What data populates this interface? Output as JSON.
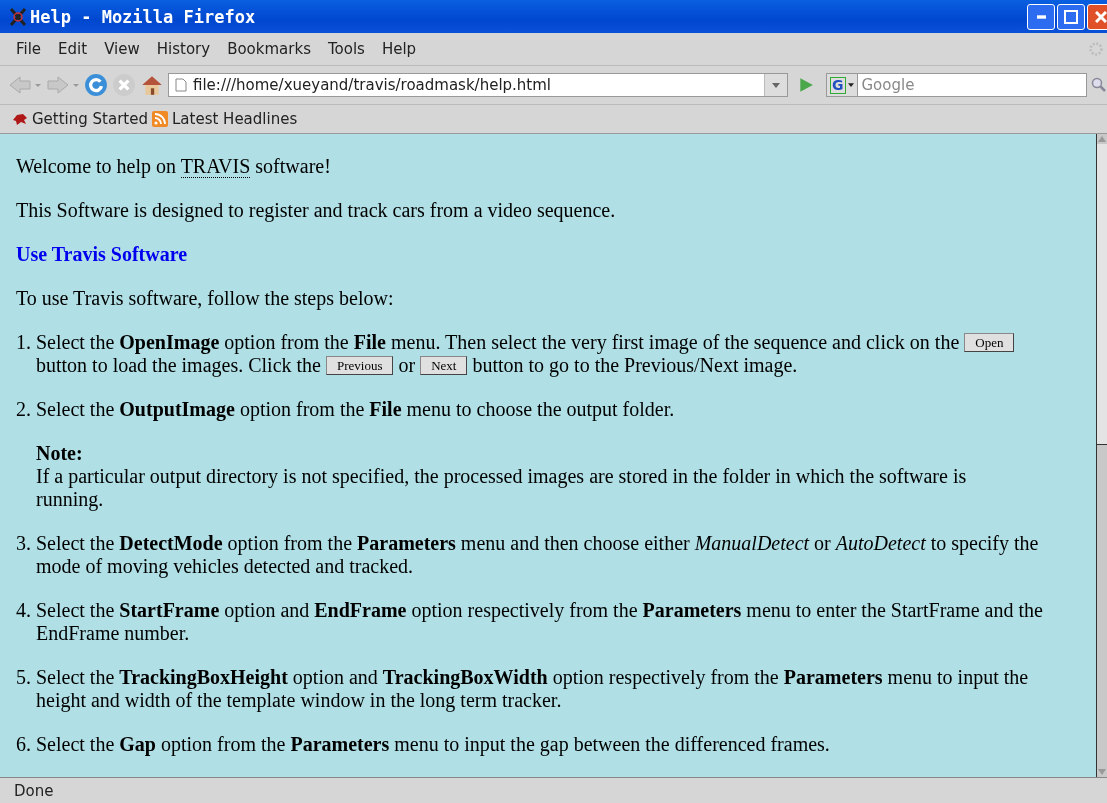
{
  "window": {
    "title": "Help - Mozilla Firefox"
  },
  "menu": [
    "File",
    "Edit",
    "View",
    "History",
    "Bookmarks",
    "Tools",
    "Help"
  ],
  "address": {
    "value": "file:///home/xueyand/travis/roadmask/help.html"
  },
  "search": {
    "engine": "G",
    "placeholder": "Google"
  },
  "bookmarks": [
    {
      "label": "Getting Started",
      "kind": "page"
    },
    {
      "label": "Latest Headlines",
      "kind": "feed"
    }
  ],
  "content": {
    "welcome": [
      {
        "kind": "text",
        "text": "Welcome to help on "
      },
      {
        "kind": "abbr",
        "text": "TRAVIS"
      },
      {
        "kind": "text",
        "text": " software!"
      }
    ],
    "intro": "This Software is designed to register and track cars from a video sequence.",
    "heading": "Use Travis Software",
    "lead": "To use Travis software, follow the steps below:",
    "steps": [
      {
        "number": "1.",
        "parts": [
          {
            "kind": "text",
            "text": "Select the **OpenImage** option from the **File** menu. Then select the very first image of the sequence and click on the "
          },
          {
            "kind": "button",
            "text": "Open"
          },
          {
            "kind": "text",
            "text": " button to load the images. Click the "
          },
          {
            "kind": "button",
            "text": "Previous"
          },
          {
            "kind": "text",
            "text": " or "
          },
          {
            "kind": "button",
            "text": "Next"
          },
          {
            "kind": "text",
            "text": " button to go to the Previous/Next image."
          }
        ]
      },
      {
        "number": "2.",
        "parts": [
          {
            "kind": "text",
            "text": "Select the **OutputImage** option from the **File** menu to choose the output folder."
          }
        ],
        "note_title": "Note:",
        "note": "If a particular output directory is not specified, the processed images are stored in the folder in which the software is running."
      },
      {
        "number": "3.",
        "parts": [
          {
            "kind": "text",
            "text": "Select the **DetectMode** option from the **Parameters** menu and then choose either *ManualDetect* or *AutoDetect* to specify the mode of moving vehicles detected and tracked."
          }
        ]
      },
      {
        "number": "4.",
        "parts": [
          {
            "kind": "text",
            "text": "Select the **StartFrame** option and **EndFrame** option respectively from the **Parameters** menu to enter the StartFrame and the EndFrame number."
          }
        ]
      },
      {
        "number": "5.",
        "parts": [
          {
            "kind": "text",
            "text": "Select the **TrackingBoxHeight** option and **TrackingBoxWidth** option respectively from the **Parameters** menu to input the height and width of the template window in the long term tracker."
          }
        ]
      },
      {
        "number": "6.",
        "parts": [
          {
            "kind": "text",
            "text": "Select the **Gap** option from the **Parameters** menu to input the gap between the differenced frames."
          }
        ]
      }
    ]
  },
  "status_bar": {
    "text": "Done"
  }
}
